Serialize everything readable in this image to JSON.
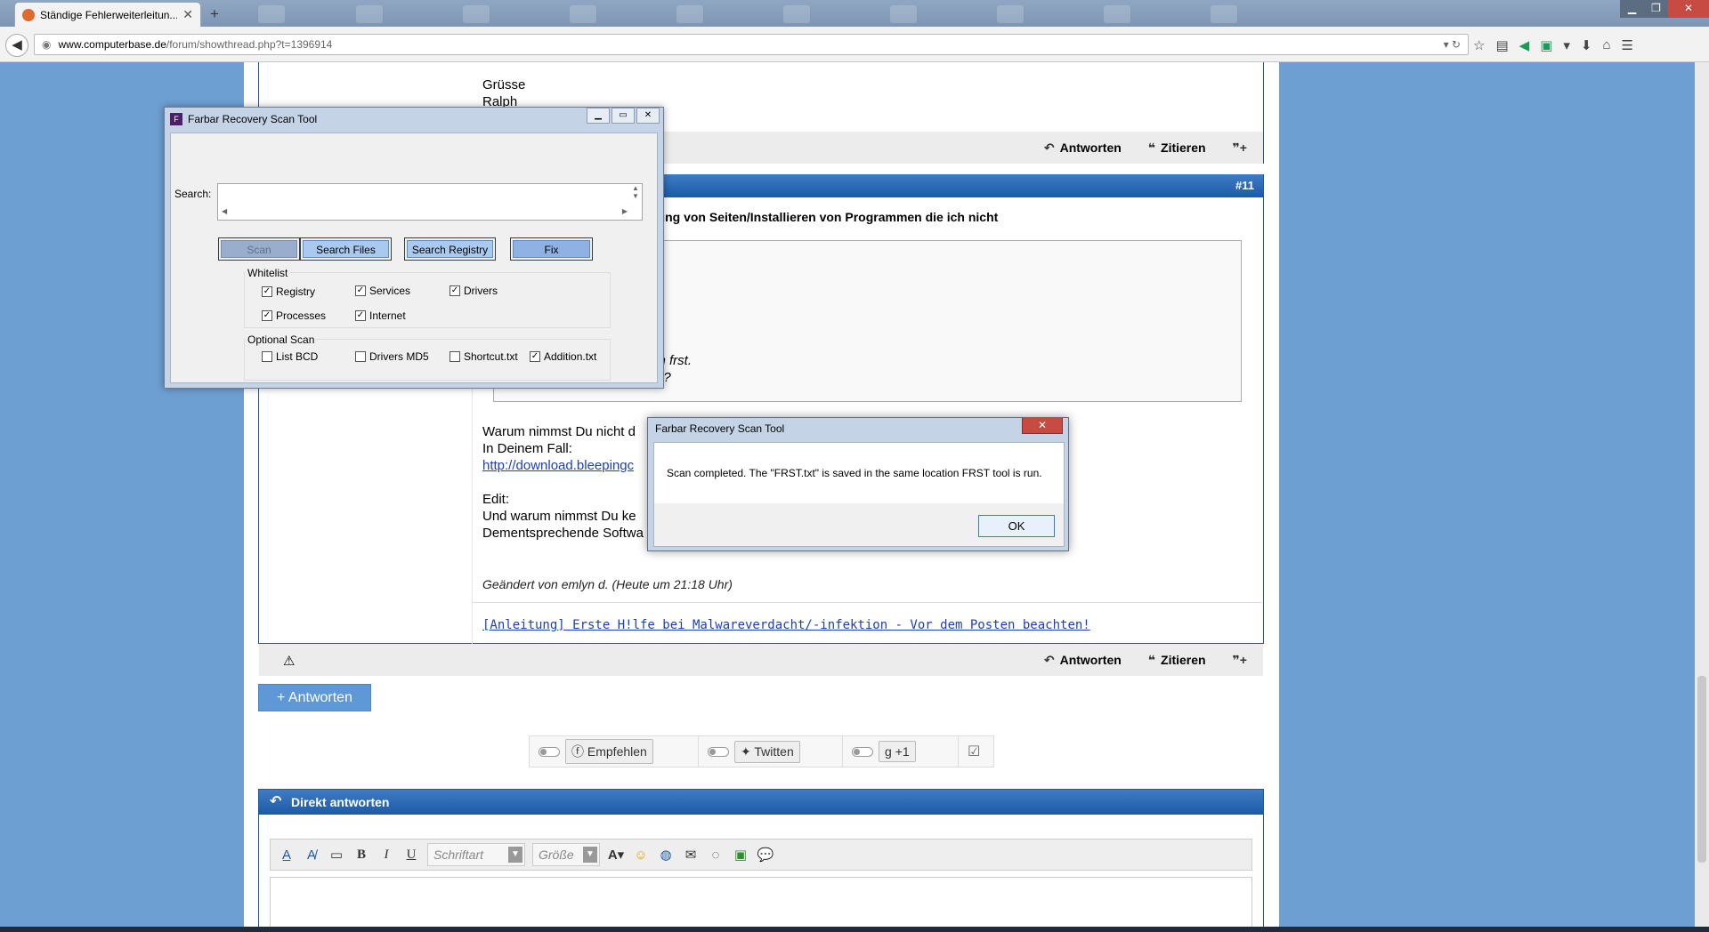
{
  "browser": {
    "tab_title": "Ständige Fehlerweiterleitun...",
    "tab_close": "✕",
    "new_tab": "+",
    "url_host": "www.computerbase.de",
    "url_path": "/forum/showthread.php?t=1396914",
    "win_minimize": "▁",
    "win_restore": "❐",
    "win_close": "✕"
  },
  "post_top": {
    "greeting": "Grüsse",
    "name": "Ralph"
  },
  "footer_actions": {
    "reply": "Antworten",
    "quote": "Zitieren"
  },
  "post11": {
    "number": "#11",
    "title": "itung von Seiten/Installieren von Programmen die ich nicht",
    "quote_line1": "ch frst.",
    "quote_line2": "er?",
    "body1": "Warum nimmst Du nicht d",
    "body2": "In Deinem Fall:",
    "link": "http://download.bleepingc",
    "body3": "Edit:",
    "body4": "Und warum nimmst Du ke",
    "body5": "Dementsprechende Softwa",
    "edited": "Geändert von emlyn d. (Heute um 21:18 Uhr)",
    "signature_link": "[Anleitung] Erste H!lfe bei Malwareverdacht/-infektion - Vor dem Posten beachten!"
  },
  "antworten_button": "+ Antworten",
  "social": {
    "facebook": "Empfehlen",
    "twitter": "Twitten",
    "gplus": "+1"
  },
  "reply_panel": {
    "title": "Direkt antworten",
    "font_select": "Schriftart",
    "size_select": "Größe"
  },
  "frst": {
    "title": "Farbar Recovery Scan Tool",
    "search_label": "Search:",
    "buttons": {
      "scan": "Scan",
      "search_files": "Search Files",
      "search_registry": "Search Registry",
      "fix": "Fix"
    },
    "whitelist_label": "Whitelist",
    "whitelist": {
      "registry": {
        "label": "Registry",
        "checked": true
      },
      "services": {
        "label": "Services",
        "checked": true
      },
      "drivers": {
        "label": "Drivers",
        "checked": true
      },
      "processes": {
        "label": "Processes",
        "checked": true
      },
      "internet": {
        "label": "Internet",
        "checked": true
      }
    },
    "optional_label": "Optional Scan",
    "optional": {
      "list_bcd": {
        "label": "List BCD",
        "checked": false
      },
      "drivers_md5": {
        "label": "Drivers MD5",
        "checked": false
      },
      "shortcut": {
        "label": "Shortcut.txt",
        "checked": false
      },
      "addition": {
        "label": "Addition.txt",
        "checked": true
      }
    }
  },
  "dialog": {
    "title": "Farbar Recovery Scan Tool",
    "message": "Scan completed. The \"FRST.txt\" is saved in the same location FRST tool is run.",
    "ok": "OK",
    "close": "✕"
  }
}
